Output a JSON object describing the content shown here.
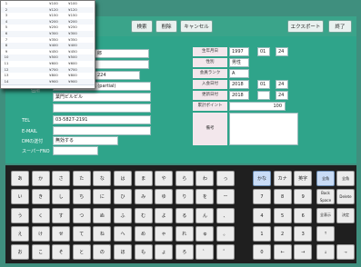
{
  "toolbar": {
    "buttons": [
      {
        "label": "検索"
      },
      {
        "label": "削除"
      },
      {
        "label": "キャンセル"
      },
      {
        "label": "エクスポート"
      },
      {
        "label": "終了"
      }
    ]
  },
  "form": {
    "left": {
      "name_suffix": "郎",
      "phone_partial": "224",
      "address_label": "住所",
      "address_line1": "東京都港区新橋 1-1 (partial)",
      "address_line2": "葉門ビルビル",
      "tel_label": "TEL",
      "tel_value": "03-5827-2191",
      "email_label": "E-MAIL",
      "dm_label": "DMの送付",
      "dm_value": "無効する",
      "group_label": "スーパーFNO"
    },
    "right": {
      "birth_label": "生年月日",
      "birth_year": "1997",
      "birth_month": "01",
      "birth_day": "24",
      "gender_label": "性別",
      "gender_value": "男性",
      "rank_label": "会員ランク",
      "rank_value": "A",
      "join_label": "入会日付",
      "join_year": "2018",
      "join_month": "01",
      "join_day": "24",
      "renew_label": "更新日付",
      "renew_year": "2018",
      "renew_month": "",
      "renew_day": "24",
      "points_label": "累計ポイント",
      "points_value": "100",
      "note_label": "備考"
    }
  },
  "keyboard": {
    "kana_rows": [
      [
        "あ",
        "か",
        "さ",
        "た",
        "な",
        "は",
        "ま",
        "や",
        "ら",
        "わ",
        "っ"
      ],
      [
        "い",
        "き",
        "し",
        "ち",
        "に",
        "ひ",
        "み",
        "ゆ",
        "り",
        "を",
        "ー"
      ],
      [
        "う",
        "く",
        "す",
        "つ",
        "ぬ",
        "ふ",
        "む",
        "よ",
        "る",
        "ん",
        "、"
      ],
      [
        "え",
        "け",
        "せ",
        "て",
        "ね",
        "へ",
        "め",
        "ゃ",
        "れ",
        "ゅ",
        "。"
      ],
      [
        "お",
        "こ",
        "そ",
        "と",
        "の",
        "ほ",
        "も",
        "ょ",
        "ろ",
        "゛",
        "゜"
      ]
    ],
    "mode_buttons": [
      "かな",
      "カナ",
      "英字"
    ],
    "numpad": [
      [
        "7",
        "8",
        "9"
      ],
      [
        "4",
        "5",
        "6"
      ],
      [
        "1",
        "2",
        "3"
      ],
      [
        "0",
        "←",
        "→"
      ]
    ],
    "side_buttons": {
      "full": "全角",
      "half": "全角",
      "backspace": "Back Space",
      "clear": "Delete",
      "enter_jp": "全表示",
      "confirm": "決定",
      "up": "↑",
      "down": "↓",
      "right": "→"
    }
  },
  "overlay_list": {
    "rows": [
      {
        "num": "1",
        "code": "¥100",
        "val": "¥100"
      },
      {
        "num": "2",
        "code": "¥120",
        "val": "¥120"
      },
      {
        "num": "3",
        "code": "¥150",
        "val": "¥150"
      },
      {
        "num": "4",
        "code": "¥200",
        "val": "¥200"
      },
      {
        "num": "5",
        "code": "¥250",
        "val": "¥250"
      },
      {
        "num": "6",
        "code": "¥300",
        "val": "¥300"
      },
      {
        "num": "7",
        "code": "¥350",
        "val": "¥350"
      },
      {
        "num": "8",
        "code": "¥400",
        "val": "¥400"
      },
      {
        "num": "9",
        "code": "¥450",
        "val": "¥450"
      },
      {
        "num": "10",
        "code": "¥500",
        "val": "¥500"
      },
      {
        "num": "11",
        "code": "¥600",
        "val": "¥600"
      },
      {
        "num": "12",
        "code": "¥700",
        "val": "¥700"
      },
      {
        "num": "13",
        "code": "¥800",
        "val": "¥800"
      },
      {
        "num": "14",
        "code": "¥900",
        "val": "¥900"
      }
    ]
  },
  "colors": {
    "app_bg": "#3f8f7e",
    "form_bg": "#2fa48a",
    "keyboard_bg": "#1f1f1f"
  }
}
